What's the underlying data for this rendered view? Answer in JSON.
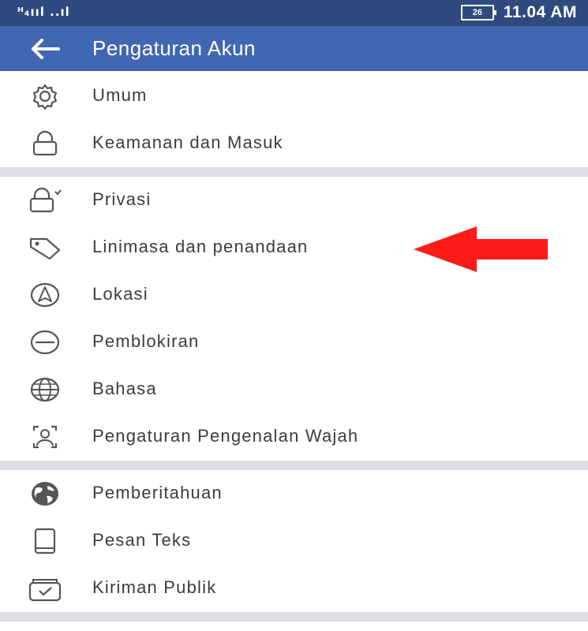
{
  "status_bar": {
    "signal": "ᴴ₄ııl ..ıl",
    "battery": "26",
    "time": "11.04 AM"
  },
  "app_bar": {
    "title": "Pengaturan Akun",
    "back_icon": "arrow-left-icon"
  },
  "sections": [
    {
      "items": [
        {
          "label": "Umum",
          "icon": "gear-icon"
        },
        {
          "label": "Keamanan dan Masuk",
          "icon": "lock-icon"
        }
      ]
    },
    {
      "items": [
        {
          "label": "Privasi",
          "icon": "lock-check-icon"
        },
        {
          "label": "Linimasa dan penandaan",
          "icon": "tag-icon"
        },
        {
          "label": "Lokasi",
          "icon": "location-arrow-icon"
        },
        {
          "label": "Pemblokiran",
          "icon": "block-icon"
        },
        {
          "label": "Bahasa",
          "icon": "globe-icon"
        },
        {
          "label": "Pengaturan Pengenalan Wajah",
          "icon": "face-scan-icon"
        }
      ]
    },
    {
      "items": [
        {
          "label": "Pemberitahuan",
          "icon": "earth-icon"
        },
        {
          "label": "Pesan Teks",
          "icon": "tablet-icon"
        },
        {
          "label": "Kiriman Publik",
          "icon": "inbox-check-icon"
        }
      ]
    }
  ],
  "annotation": {
    "icon": "red-arrow-icon",
    "color": "#ff1a1a"
  }
}
